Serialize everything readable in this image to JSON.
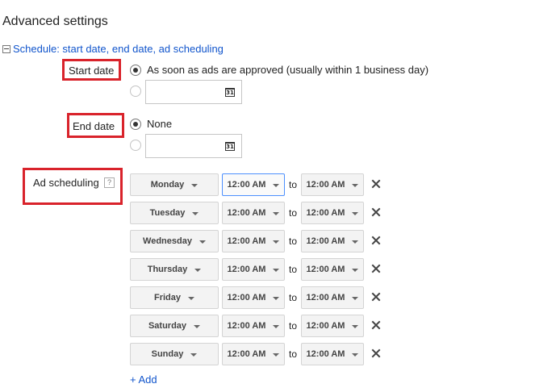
{
  "section_title": "Advanced settings",
  "schedule_section": {
    "toggle_icon": "collapse-minus-icon",
    "link_text": "Schedule: start date, end date, ad scheduling"
  },
  "start_date": {
    "label": "Start date",
    "options": [
      {
        "label": "As soon as ads are approved (usually within 1 business day)",
        "checked": true
      },
      {
        "label": "",
        "checked": false,
        "input_value": ""
      }
    ]
  },
  "end_date": {
    "label": "End date",
    "options": [
      {
        "label": "None",
        "checked": true
      },
      {
        "label": "",
        "checked": false,
        "input_value": ""
      }
    ]
  },
  "calendar_icon_text": "31",
  "ad_scheduling": {
    "label": "Ad scheduling",
    "help_icon_text": "?",
    "to_label": "to",
    "rows": [
      {
        "day": "Monday",
        "start": "12:00 AM",
        "end": "12:00 AM"
      },
      {
        "day": "Tuesday",
        "start": "12:00 AM",
        "end": "12:00 AM"
      },
      {
        "day": "Wednesday",
        "start": "12:00 AM",
        "end": "12:00 AM"
      },
      {
        "day": "Thursday",
        "start": "12:00 AM",
        "end": "12:00 AM"
      },
      {
        "day": "Friday",
        "start": "12:00 AM",
        "end": "12:00 AM"
      },
      {
        "day": "Saturday",
        "start": "12:00 AM",
        "end": "12:00 AM"
      },
      {
        "day": "Sunday",
        "start": "12:00 AM",
        "end": "12:00 AM"
      }
    ],
    "add_label": "+ Add"
  },
  "colors": {
    "link": "#1155cc",
    "highlight_border": "#d9232b",
    "focus_border": "#4d90fe"
  }
}
